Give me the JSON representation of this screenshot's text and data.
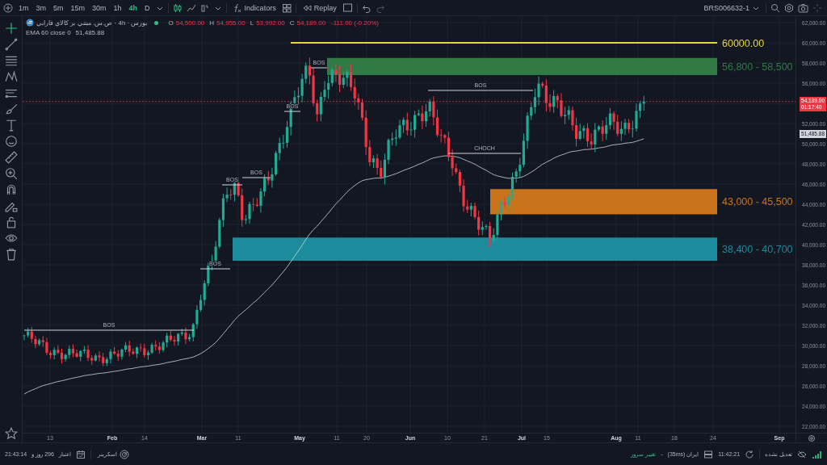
{
  "toolbar": {
    "intervals": [
      {
        "label": "1m",
        "selected": false
      },
      {
        "label": "3m",
        "selected": false
      },
      {
        "label": "5m",
        "selected": false
      },
      {
        "label": "15m",
        "selected": false
      },
      {
        "label": "30m",
        "selected": false
      },
      {
        "label": "1h",
        "selected": false
      },
      {
        "label": "4h",
        "selected": true
      },
      {
        "label": "D",
        "selected": false
      }
    ],
    "indicators_label": "Indicators",
    "replay_label": "Replay",
    "symbol": "BRS006632-1"
  },
  "left_toolbar": {
    "tools": [
      {
        "kind": "crosshair",
        "selected": true
      },
      {
        "kind": "trend",
        "selected": false
      },
      {
        "kind": "lines",
        "selected": false
      },
      {
        "kind": "pattern",
        "selected": false
      },
      {
        "kind": "projection",
        "selected": false
      },
      {
        "kind": "brush",
        "selected": false
      },
      {
        "kind": "text",
        "selected": false
      },
      {
        "kind": "emoji",
        "selected": false
      },
      {
        "kind": "ruler",
        "selected": false
      },
      {
        "kind": "zoom",
        "selected": false
      },
      {
        "kind": "magnet",
        "selected": false
      },
      {
        "kind": "drawlock",
        "selected": false
      },
      {
        "kind": "lock",
        "selected": false
      },
      {
        "kind": "eye",
        "selected": false
      },
      {
        "kind": "trash",
        "selected": false
      }
    ]
  },
  "legend": {
    "title": "بورس · 4h · ص.س. مبتني بر كالاي فارابي",
    "ohlc": [
      {
        "key": "O",
        "value": "54,500.00"
      },
      {
        "key": "H",
        "value": "54,955.00"
      },
      {
        "key": "L",
        "value": "53,992.00"
      },
      {
        "key": "C",
        "value": "54,189.00"
      }
    ],
    "change": "-111.00 (-0.20%)",
    "indicator": {
      "name": "EMA 60 close 0",
      "value": "51,485.88"
    }
  },
  "chart": {
    "levels": [
      {
        "kind": "line",
        "label": "60000.00",
        "color": "#e6d440"
      },
      {
        "kind": "zone",
        "label": "56,800 - 58,500",
        "color": "#2f7a45"
      },
      {
        "kind": "zone",
        "label": "43,000 - 45,500",
        "color": "#c9731c"
      },
      {
        "kind": "zone",
        "label": "38,400 - 40,700",
        "color": "#1c8c9c"
      }
    ],
    "markers": [
      {
        "label": "BOS"
      },
      {
        "label": "BOS"
      },
      {
        "label": "BOS"
      },
      {
        "label": "BOS"
      },
      {
        "label": "BOS"
      },
      {
        "label": "BOS"
      },
      {
        "label": "BOS"
      },
      {
        "label": "CHOCH"
      }
    ]
  },
  "price_axis": {
    "ticks": [
      "62,000.00",
      "60,000.00",
      "58,000.00",
      "56,000.00",
      "52,000.00",
      "50,000.00",
      "48,000.00",
      "46,000.00",
      "44,000.00",
      "42,000.00",
      "40,000.00",
      "38,000.00",
      "36,000.00",
      "34,000.00",
      "32,000.00",
      "30,000.00",
      "28,000.00",
      "26,000.00",
      "24,000.00",
      "22,000.00"
    ],
    "last_price": "54,189.00",
    "countdown": "01:17:40",
    "ema_price": "51,485.88"
  },
  "time_axis": {
    "ticks": [
      {
        "label": "13",
        "kind": "day"
      },
      {
        "label": "Feb",
        "kind": "month"
      },
      {
        "label": "14",
        "kind": "day"
      },
      {
        "label": "Mar",
        "kind": "month"
      },
      {
        "label": "11",
        "kind": "day"
      },
      {
        "label": "May",
        "kind": "month"
      },
      {
        "label": "11",
        "kind": "day"
      },
      {
        "label": "20",
        "kind": "day"
      },
      {
        "label": "Jun",
        "kind": "month"
      },
      {
        "label": "10",
        "kind": "day"
      },
      {
        "label": "21",
        "kind": "day"
      },
      {
        "label": "Jul",
        "kind": "month"
      },
      {
        "label": "15",
        "kind": "day"
      },
      {
        "label": "Aug",
        "kind": "month"
      },
      {
        "label": "11",
        "kind": "day"
      },
      {
        "label": "18",
        "kind": "day"
      },
      {
        "label": "24",
        "kind": "day"
      },
      {
        "label": "Sep",
        "kind": "month"
      }
    ]
  },
  "status_bar": {
    "clock": "21:43:14",
    "days": "296 روز و",
    "credit_label": "اعتبار",
    "screener_label": "اسکرینر",
    "server_change": "تغییر سرور",
    "separator": "-",
    "server": "ایران (35ms)",
    "server_time": "11:42:21",
    "adjustment": "تعدیل نشده"
  }
}
